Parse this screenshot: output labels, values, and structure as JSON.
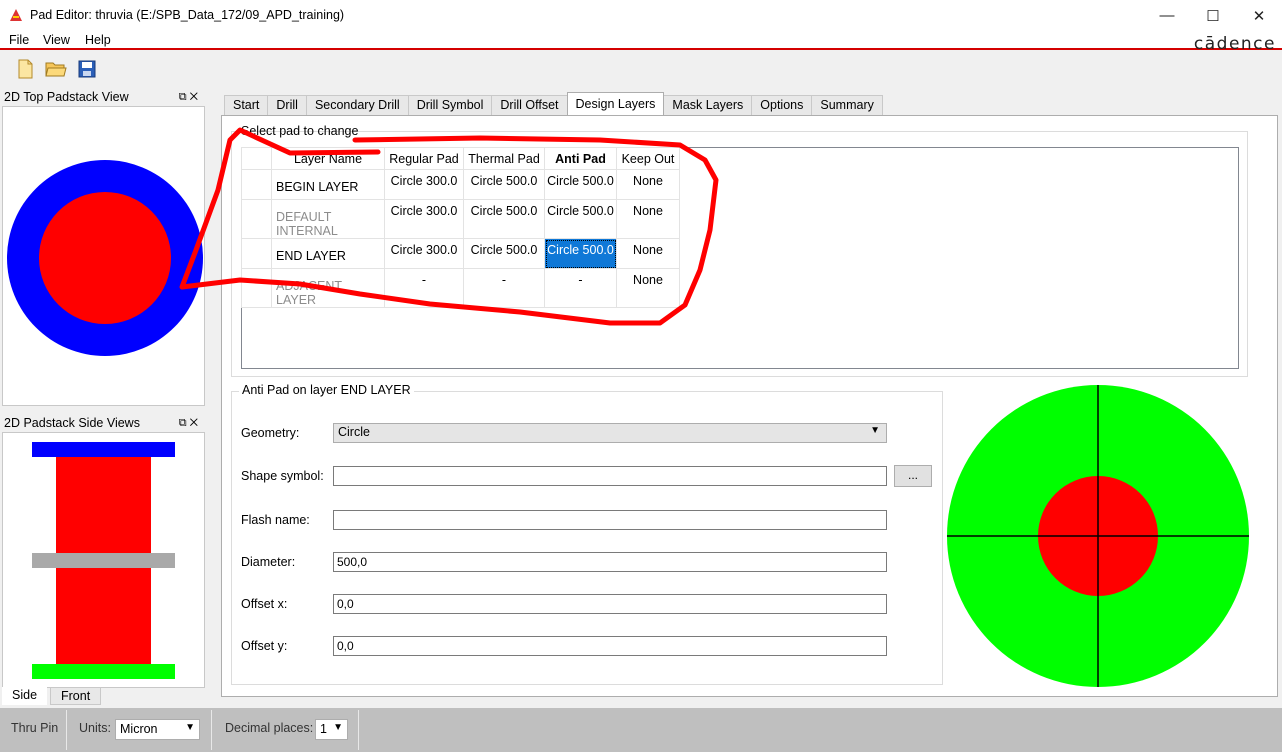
{
  "window": {
    "title": "Pad Editor: thruvia  (E:/SPB_Data_172/09_APD_training)"
  },
  "menu": {
    "file": "File",
    "view": "View",
    "help": "Help",
    "brand": "cādence"
  },
  "panels": {
    "top_view_title": "2D Top Padstack View",
    "side_view_title": "2D Padstack Side Views",
    "side_tab": "Side",
    "front_tab": "Front"
  },
  "tabs": [
    "Start",
    "Drill",
    "Secondary Drill",
    "Drill Symbol",
    "Drill Offset",
    "Design Layers",
    "Mask Layers",
    "Options",
    "Summary"
  ],
  "active_tab": "Design Layers",
  "design_layers": {
    "select_label": "Select pad to change",
    "headers": [
      "Layer Name",
      "Regular Pad",
      "Thermal Pad",
      "Anti Pad",
      "Keep Out"
    ],
    "rows": [
      {
        "layer": "BEGIN LAYER",
        "regular": "Circle 300.0",
        "thermal": "Circle 500.0",
        "anti": "Circle 500.0",
        "keepout": "None"
      },
      {
        "layer": "DEFAULT INTERNAL",
        "regular": "Circle 300.0",
        "thermal": "Circle 500.0",
        "anti": "Circle 500.0",
        "keepout": "None"
      },
      {
        "layer": "END LAYER",
        "regular": "Circle 300.0",
        "thermal": "Circle 500.0",
        "anti": "Circle 500.0",
        "keepout": "None"
      },
      {
        "layer": "ADJACENT LAYER",
        "regular": "-",
        "thermal": "-",
        "anti": "-",
        "keepout": "None"
      }
    ]
  },
  "pad_editor": {
    "title": "Anti Pad on layer END LAYER",
    "geometry_label": "Geometry:",
    "geometry_value": "Circle",
    "shape_symbol_label": "Shape symbol:",
    "shape_symbol_value": "",
    "browse_label": "...",
    "flash_name_label": "Flash name:",
    "flash_name_value": "",
    "diameter_label": "Diameter:",
    "diameter_value": "500,0",
    "offset_x_label": "Offset x:",
    "offset_x_value": "0,0",
    "offset_y_label": "Offset y:",
    "offset_y_value": "0,0"
  },
  "status": {
    "pin_type": "Thru Pin",
    "units_label": "Units:",
    "units_value": "Micron",
    "decimal_label": "Decimal places:",
    "decimal_value": "1"
  },
  "colors": {
    "pad": "#ff0000",
    "antipad": "#00ff00",
    "top_ring": "#0000ff",
    "annotation": "#ff0000",
    "selection": "#0f78d7",
    "menu_rule": "#d40000"
  }
}
